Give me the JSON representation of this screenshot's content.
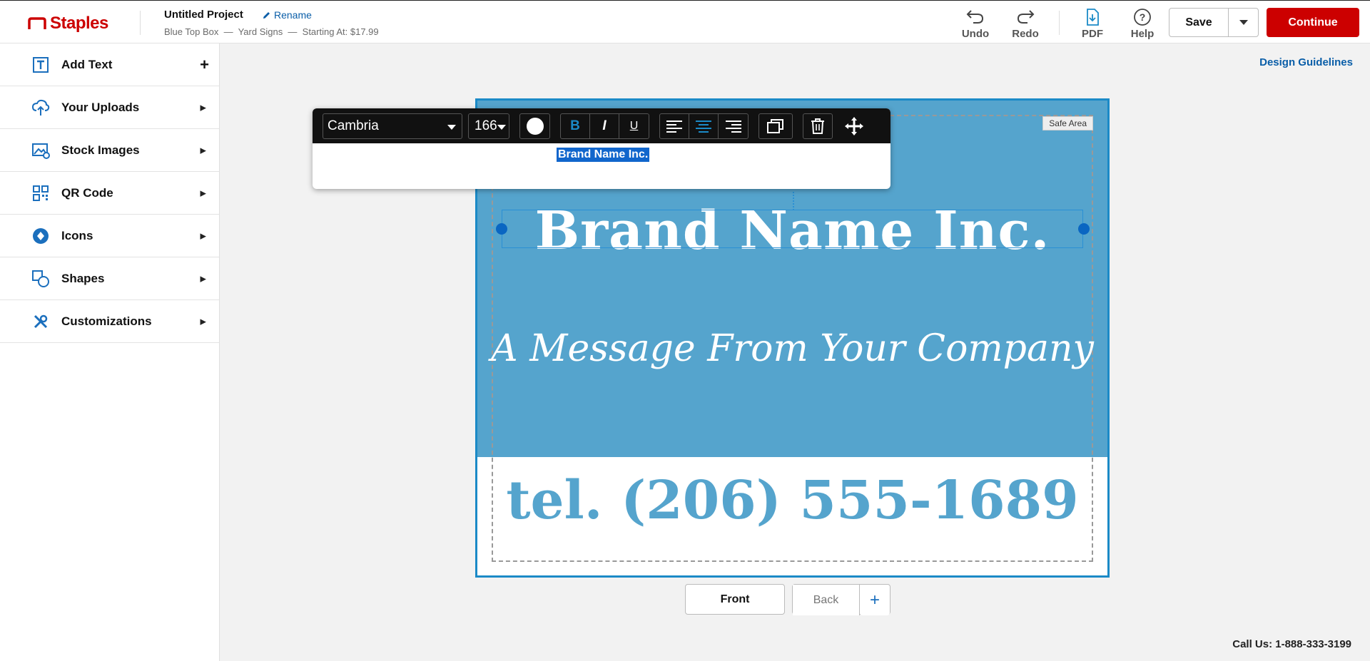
{
  "header": {
    "logo": "Staples",
    "project_title": "Untitled Project",
    "rename_label": "Rename",
    "breadcrumb": "Blue Top Box  —  Yard Signs  —  Starting At: $17.99",
    "undo_label": "Undo",
    "redo_label": "Redo",
    "pdf_label": "PDF",
    "help_label": "Help",
    "save_label": "Save",
    "continue_label": "Continue",
    "brand_color": "#cc0000"
  },
  "sidebar": {
    "items": [
      {
        "label": "Add Text",
        "icon": "text-box-icon"
      },
      {
        "label": "Your Uploads",
        "icon": "cloud-upload-icon"
      },
      {
        "label": "Stock Images",
        "icon": "image-icon"
      },
      {
        "label": "QR Code",
        "icon": "qr-code-icon"
      },
      {
        "label": "Icons",
        "icon": "circle-icon"
      },
      {
        "label": "Shapes",
        "icon": "shapes-icon"
      },
      {
        "label": "Customizations",
        "icon": "tools-icon"
      }
    ]
  },
  "canvas": {
    "design_guidelines": "Design Guidelines",
    "safe_area_label": "Safe Area",
    "headline": "Brand Name Inc.",
    "message": "A Message From Your Company",
    "phone": "tel. (206) 555-1689",
    "sign_color": "#55a4cd"
  },
  "text_editor": {
    "font": "Cambria",
    "size": "166",
    "text": "Brand Name Inc.",
    "color": "#ffffff",
    "bold": true,
    "align": "center"
  },
  "pages": {
    "front": "Front",
    "back": "Back",
    "add": "+"
  },
  "footer": {
    "call": "Call Us: 1-888-333-3199"
  }
}
